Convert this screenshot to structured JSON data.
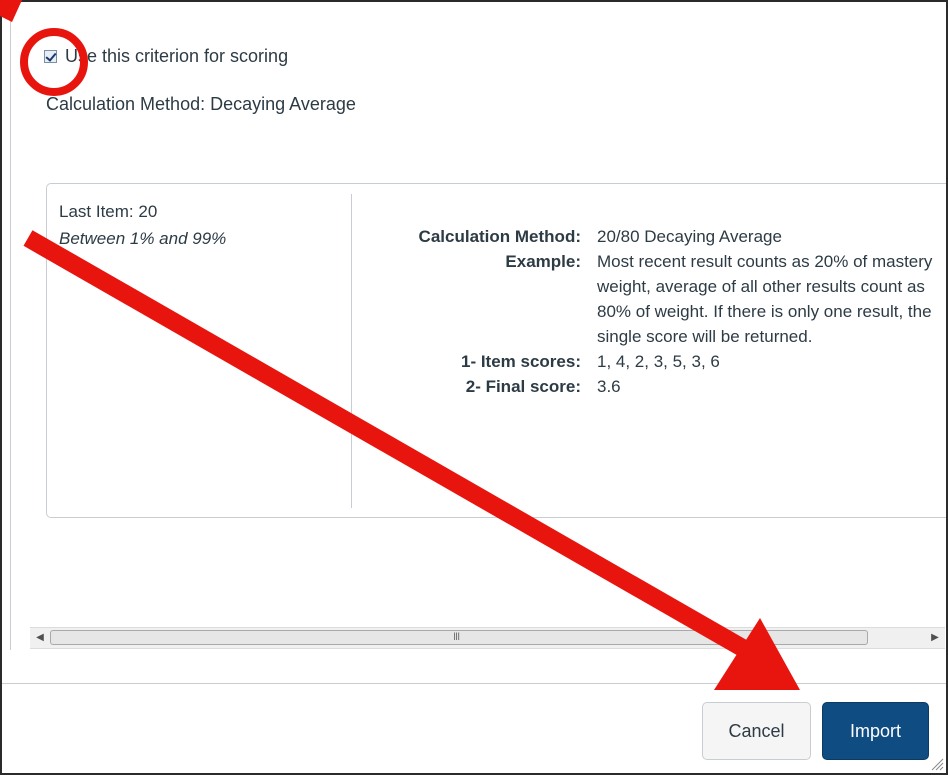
{
  "criterion": {
    "checkbox_checked": true,
    "use_label": "Use this criterion for scoring",
    "calculation_method_line": "Calculation Method: Decaying Average"
  },
  "rating": {
    "title": "Last Item: 20",
    "range": "Between 1% and 99%"
  },
  "details": [
    {
      "key": "Calculation Method:",
      "value": "20/80 Decaying Average"
    },
    {
      "key": "Example:",
      "value": "Most recent result counts as 20% of mastery weight, average of all other results count as 80% of weight. If there is only one result, the single score will be returned."
    },
    {
      "key": "1- Item scores:",
      "value": "1, 4, 2, 3, 5, 3, 6"
    },
    {
      "key": "2- Final score:",
      "value": "3.6"
    }
  ],
  "scrollbar": {
    "left_arrow": "◀",
    "right_arrow": "▶",
    "grip": "III"
  },
  "buttons": {
    "cancel": "Cancel",
    "import": "Import"
  },
  "annotation": {
    "color": "#e8150f"
  },
  "icons": {
    "checkbox": "checkbox-icon",
    "resize": "resize-grip-icon"
  }
}
